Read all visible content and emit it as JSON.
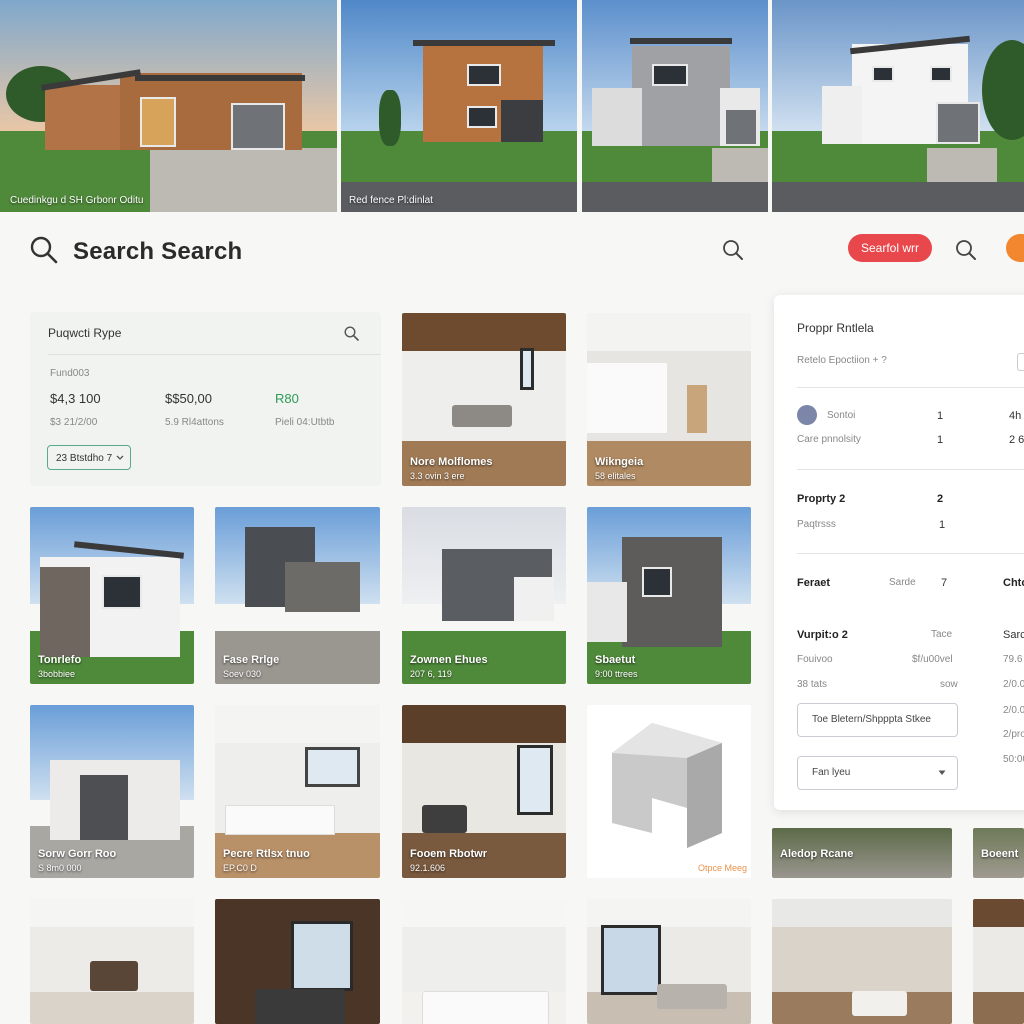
{
  "hero": {
    "captions": [
      "Cuedinkgu d SH Grbonr Oditu",
      "Red fence Pl:dinlat"
    ]
  },
  "search": {
    "title": "Search Search",
    "pill_button": "Searfol wrr"
  },
  "filter": {
    "title": "Puqwcti Rype",
    "label_top": "Fund003",
    "price_1": "$4,3 100",
    "price_2": "$$50,00",
    "price_3": "R80",
    "sub_1": "$3 21/2/00",
    "sub_2": "5.9 Rl4attons",
    "sub_3": "Pieli 04:Utbtb",
    "select_label": "23 Btstdho 7"
  },
  "tiles": [
    {
      "title": "Nore Molflomes",
      "sub": "3.3 ovin 3 ere"
    },
    {
      "title": "Wikngeia",
      "sub": "58 elitales"
    },
    {
      "title": "Tonrlefo",
      "sub": "3bobbiee"
    },
    {
      "title": "Fase Rrlge",
      "sub": "Soev 030"
    },
    {
      "title": "Zownen Ehues",
      "sub": "207 6, 119"
    },
    {
      "title": "Sbaetut",
      "sub": "9:00 ttrees"
    },
    {
      "title": "Sorw Gorr Roo",
      "sub": "S 8m0 000"
    },
    {
      "title": "Pecre Rtlsx tnuo",
      "sub": "EP.C0 D"
    },
    {
      "title": "Fooem Rbotwr",
      "sub": "92.1.606"
    },
    {
      "title": "",
      "sub": "Otpce Meeg"
    },
    {
      "title": "Aledop Rcane",
      "sub": ""
    },
    {
      "title": "Boeent",
      "sub": ""
    }
  ],
  "panel": {
    "title": "Proppr Rntlela",
    "sub": "Retelo Epoctiion + ?",
    "row1_label": "Sontoi",
    "row1_a": "1",
    "row1_b": "4h",
    "row2_label": "Care pnnolsity",
    "row2_a": "1",
    "row2_b": "2 6",
    "prop2_label": "Proprty 2",
    "prop2_val": "2",
    "pastess": "Paqtrsss",
    "pastess_val": "1",
    "feat_label": "Feraet",
    "feat_b": "Sarde",
    "feat_c": "7",
    "feat_d": "Chto",
    "vp_label": "Vurpit:o 2",
    "vp_b": "Tace",
    "vp_c": "Sarc",
    "fv_label": "Fouivoo",
    "fv_b": "$f/u00vel",
    "fv_c": "79.6",
    "s3_label": "38 tats",
    "s3_b": "sow",
    "s3_c": "2/0.0",
    "input1": "Toe Bletern/Shpppta Stkee",
    "input1_side": "2/0.0",
    "input2": "Fan lyeu",
    "side_4": "2/pro",
    "side_5": "50:00"
  },
  "colors": {
    "accent_red": "#e8474b",
    "accent_orange": "#f2872f",
    "accent_green": "#2f9a58"
  },
  "icons": [
    "search-icon",
    "chevron-down-icon",
    "avatar-icon"
  ]
}
